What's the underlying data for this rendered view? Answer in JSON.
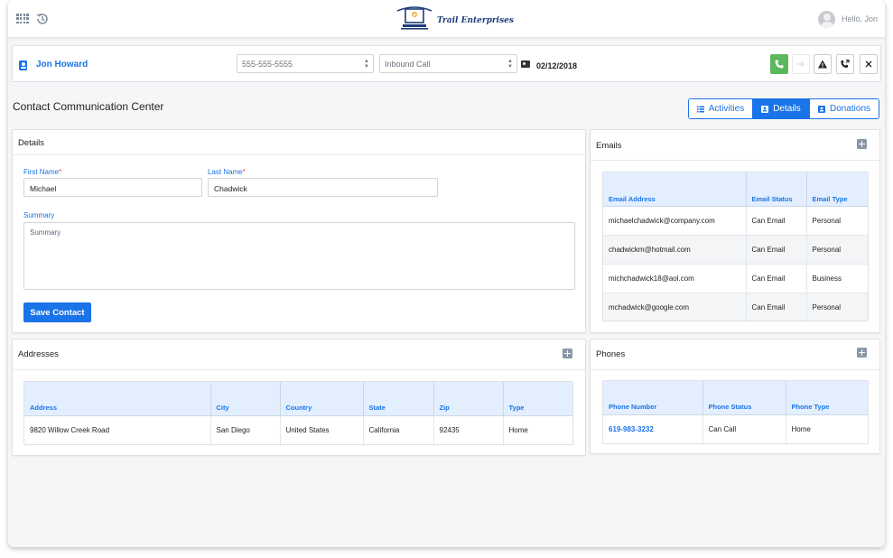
{
  "header": {
    "logo_text": "Trail Enterprises",
    "greeting": "Hello, Jon"
  },
  "callbar": {
    "contact_name": "Jon Howard",
    "phone_value": "555-555-5555",
    "call_type": "Inbound Call",
    "date": "02/12/2018"
  },
  "page": {
    "title": "Contact Communication Center",
    "tabs": [
      {
        "label": "Activities"
      },
      {
        "label": "Details"
      },
      {
        "label": "Donations"
      }
    ]
  },
  "details": {
    "heading": "Details",
    "first_name_label": "First Name",
    "first_name_value": "Michael",
    "last_name_label": "Last Name",
    "last_name_value": "Chadwick",
    "summary_label": "Summary",
    "summary_placeholder": "Summary",
    "save_label": "Save Contact"
  },
  "addresses": {
    "heading": "Addresses",
    "columns": [
      "Address",
      "City",
      "Country",
      "State",
      "Zip",
      "Type"
    ],
    "rows": [
      [
        "9820 Willow Creek Road",
        "San Diego",
        "United States",
        "California",
        "92435",
        "Home"
      ]
    ]
  },
  "emails": {
    "heading": "Emails",
    "columns": [
      "Email Address",
      "Email Status",
      "Email Type"
    ],
    "rows": [
      [
        "michaelchadwick@company.com",
        "Can Email",
        "Personal"
      ],
      [
        "chadwickm@hotmail.com",
        "Can Email",
        "Personal"
      ],
      [
        "michchadwick18@aol.com",
        "Can Email",
        "Business"
      ],
      [
        "mchadwick@google.com",
        "Can Email",
        "Personal"
      ]
    ]
  },
  "phones": {
    "heading": "Phones",
    "columns": [
      "Phone Number",
      "Phone Status",
      "Phone Type"
    ],
    "rows": [
      [
        "619-983-3232",
        "Can Call",
        "Home"
      ]
    ]
  }
}
